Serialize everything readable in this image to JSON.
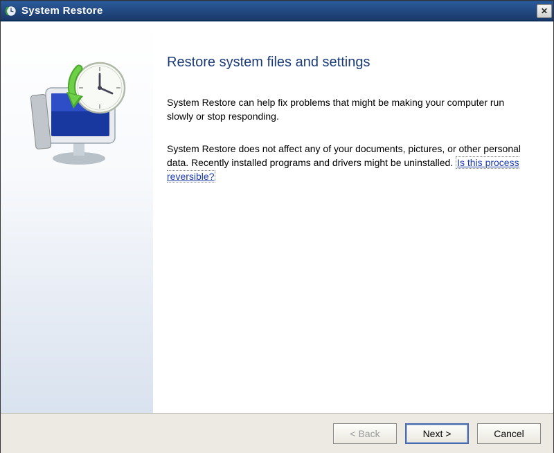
{
  "window": {
    "title": "System Restore"
  },
  "sidebar": {
    "icon_name": "system-restore-icon"
  },
  "main": {
    "heading": "Restore system files and settings",
    "paragraph1": "System Restore can help fix problems that might be making your computer run slowly or stop responding.",
    "paragraph2_pre": "System Restore does not affect any of your documents, pictures, or other personal data. Recently installed programs and drivers might be uninstalled. ",
    "paragraph2_link": "Is this process reversible?"
  },
  "footer": {
    "back_label": "< Back",
    "next_label": "Next >",
    "cancel_label": "Cancel"
  }
}
